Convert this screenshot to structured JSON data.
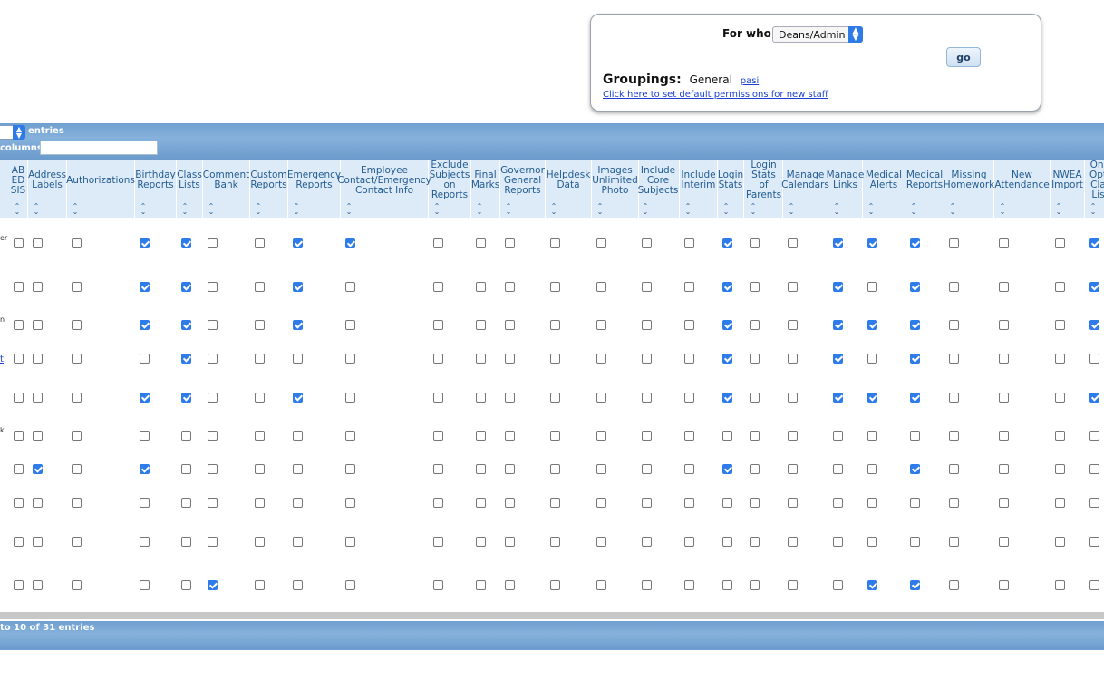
{
  "permissions_panel": {
    "for_who_label": "For who:",
    "for_who_value": "Deans/Admin",
    "go_label": "go",
    "groupings_label": "Groupings:",
    "groupings_general": "General",
    "groupings_link": "pasi",
    "default_link": "Click here to set default permissions for new staff"
  },
  "table_controls": {
    "entries_label": "entries",
    "columns_label": "columns:"
  },
  "columns": [
    {
      "label": "AB ED SIS"
    },
    {
      "label": "Address Labels"
    },
    {
      "label": "Authorizations"
    },
    {
      "label": "Birthday Reports"
    },
    {
      "label": "Class Lists"
    },
    {
      "label": "Comment Bank"
    },
    {
      "label": "Custom Reports"
    },
    {
      "label": "Emergency Reports"
    },
    {
      "label": "Employee Contact/Emergency Contact Info"
    },
    {
      "label": "Exclude Subjects on Reports"
    },
    {
      "label": "Final Marks"
    },
    {
      "label": "Governor General Reports"
    },
    {
      "label": "Helpdesk Data"
    },
    {
      "label": "Images Unlimited Photo"
    },
    {
      "label": "Include Core Subjects"
    },
    {
      "label": "Include Interim"
    },
    {
      "label": "Login Stats"
    },
    {
      "label": "Login Stats of Parents"
    },
    {
      "label": "Manage Calendars"
    },
    {
      "label": "Manage Links"
    },
    {
      "label": "Medical Alerts"
    },
    {
      "label": "Medical Reports"
    },
    {
      "label": "Missing Homework"
    },
    {
      "label": "New Attendance"
    },
    {
      "label": "NWEA Import"
    },
    {
      "label": "Onl Opt Cla Lis"
    }
  ],
  "row_labels": [
    "er",
    "",
    "n",
    "t",
    "",
    "k",
    "",
    "",
    "",
    ""
  ],
  "rows": [
    [
      0,
      0,
      0,
      1,
      1,
      0,
      0,
      1,
      1,
      0,
      0,
      0,
      0,
      0,
      0,
      0,
      1,
      0,
      0,
      1,
      1,
      1,
      0,
      0,
      0,
      1
    ],
    [
      0,
      0,
      0,
      1,
      1,
      0,
      0,
      1,
      0,
      0,
      0,
      0,
      0,
      0,
      0,
      0,
      1,
      0,
      0,
      1,
      0,
      1,
      0,
      0,
      0,
      1
    ],
    [
      0,
      0,
      0,
      1,
      1,
      0,
      0,
      1,
      0,
      0,
      0,
      0,
      0,
      0,
      0,
      0,
      1,
      0,
      0,
      1,
      1,
      1,
      0,
      0,
      0,
      1
    ],
    [
      0,
      0,
      0,
      0,
      1,
      0,
      0,
      0,
      0,
      0,
      0,
      0,
      0,
      0,
      0,
      0,
      1,
      0,
      0,
      1,
      0,
      1,
      0,
      0,
      0,
      0
    ],
    [
      0,
      0,
      0,
      1,
      1,
      0,
      0,
      1,
      0,
      0,
      0,
      0,
      0,
      0,
      0,
      0,
      1,
      0,
      0,
      1,
      1,
      1,
      0,
      0,
      0,
      1
    ],
    [
      0,
      0,
      0,
      0,
      0,
      0,
      0,
      0,
      0,
      0,
      0,
      0,
      0,
      0,
      0,
      0,
      0,
      0,
      0,
      0,
      0,
      0,
      0,
      0,
      0,
      0
    ],
    [
      0,
      1,
      0,
      1,
      0,
      0,
      0,
      0,
      0,
      0,
      0,
      0,
      0,
      0,
      0,
      0,
      1,
      0,
      0,
      0,
      0,
      1,
      0,
      0,
      0,
      0
    ],
    [
      0,
      0,
      0,
      0,
      0,
      0,
      0,
      0,
      0,
      0,
      0,
      0,
      0,
      0,
      0,
      0,
      0,
      0,
      0,
      0,
      0,
      0,
      0,
      0,
      0,
      0
    ],
    [
      0,
      0,
      0,
      0,
      0,
      0,
      0,
      0,
      0,
      0,
      0,
      0,
      0,
      0,
      0,
      0,
      0,
      0,
      0,
      0,
      0,
      0,
      0,
      0,
      0,
      0
    ],
    [
      0,
      0,
      0,
      0,
      0,
      1,
      0,
      0,
      0,
      0,
      0,
      0,
      0,
      0,
      0,
      0,
      0,
      0,
      0,
      0,
      1,
      1,
      0,
      0,
      0,
      0
    ]
  ],
  "footer": {
    "info": "to 10 of 31 entries"
  }
}
